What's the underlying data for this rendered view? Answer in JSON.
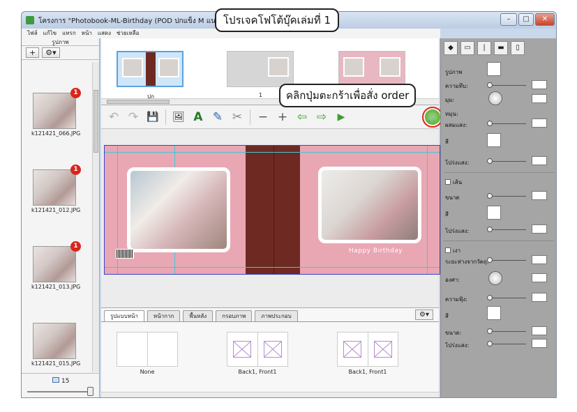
{
  "window": {
    "title": "โครงการ \"Photobook-ML-Birthday (POD ปกแข็ง M แนวนอน)\"",
    "controls": {
      "minimize": "–",
      "maximize": "□",
      "close": "✕"
    }
  },
  "menu": [
    "ไฟล์",
    "แก้ไข",
    "แทรก",
    "หน้า",
    "แสดง",
    "ช่วยเหลือ"
  ],
  "left_panel": {
    "header": "รูปภาพ",
    "add_label": "+",
    "settings_label": "⚙▾",
    "photos": [
      {
        "caption": "k121421_066.JPG",
        "badge": "1"
      },
      {
        "caption": "k121421_012.JPG",
        "badge": "1"
      },
      {
        "caption": "k121421_013.JPG",
        "badge": "1"
      },
      {
        "caption": "k121421_015.JPG",
        "badge": ""
      }
    ],
    "count": "15"
  },
  "page_strip": {
    "labels": [
      "ปก",
      "1"
    ]
  },
  "toolbar": {
    "icons": [
      "undo-icon",
      "redo-icon",
      "save-icon",
      "add-photo-icon",
      "add-text-icon",
      "image-edit-icon",
      "clipart-icon",
      "zoom-out-icon",
      "zoom-in-icon",
      "arrow-left-icon",
      "arrow-right-icon",
      "play-icon",
      "cart-icon"
    ],
    "glyphs": {
      "undo": "↶",
      "redo": "↷",
      "save": "💾",
      "add_photo": "🖼",
      "add_text": "A",
      "image_edit": "✎",
      "clipart": "✂",
      "zoom_out": "−",
      "zoom_in": "+",
      "left": "⇦",
      "right": "⇨",
      "play": "▶",
      "cart": "🛒"
    }
  },
  "canvas": {
    "happy_text": "Happy Birthday"
  },
  "layout_panel": {
    "tabs": [
      "รูปแบบหน้า",
      "หน้ากาก",
      "พื้นหลัง",
      "กรอบภาพ",
      "ภาพประกอบ"
    ],
    "gear_label": "⚙▾",
    "items": [
      {
        "label": "None"
      },
      {
        "label": "Back1, Front1"
      },
      {
        "label": "Back1, Front1"
      }
    ]
  },
  "right_panel": {
    "sections": {
      "photo": {
        "header": "รูปภาพ",
        "rows": [
          "ความทึบ:",
          "มุม:",
          "หมุน:",
          "ผสมแสง:",
          "สี",
          "โปร่งแสง:"
        ]
      },
      "border": {
        "header": "เส้น",
        "rows": [
          "ขนาด",
          "สี",
          "โปร่งแสง:"
        ]
      },
      "shadow": {
        "header": "เงา",
        "rows": [
          "ระยะห่างจากวัตถุ:",
          "องศา:",
          "ความฟุ้ง:",
          "สี",
          "ขนาด:",
          "โปร่งแสง:"
        ]
      }
    }
  },
  "callouts": {
    "title": "โปรเจคโฟโต้บุ๊คเล่มที่ 1",
    "cart": "คลิกปุ่มตะกร้าเพื่อสั่ง order"
  },
  "colors": {
    "accent_red": "#e0241b",
    "spine_brown": "#6e2a22",
    "page_pink": "#e9a7b4",
    "cart_green": "#3e9c1e"
  }
}
